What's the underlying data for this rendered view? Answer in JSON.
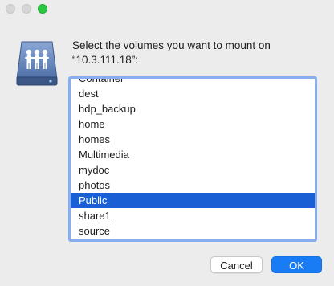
{
  "window": {
    "prompt": "Select the volumes you want to mount on\n“10.3.111.18”:"
  },
  "icon": {
    "name": "server-share-icon"
  },
  "volumes": [
    {
      "label": "Container",
      "selected": false
    },
    {
      "label": "dest",
      "selected": false
    },
    {
      "label": "hdp_backup",
      "selected": false
    },
    {
      "label": "home",
      "selected": false
    },
    {
      "label": "homes",
      "selected": false
    },
    {
      "label": "Multimedia",
      "selected": false
    },
    {
      "label": "mydoc",
      "selected": false
    },
    {
      "label": "photos",
      "selected": false
    },
    {
      "label": "Public",
      "selected": true
    },
    {
      "label": "share1",
      "selected": false
    },
    {
      "label": "source",
      "selected": false
    }
  ],
  "buttons": {
    "cancel_label": "Cancel",
    "ok_label": "OK"
  },
  "colors": {
    "selection": "#1a5fd4",
    "accent": "#1a7cf5",
    "focus_ring": "#86aef0"
  }
}
